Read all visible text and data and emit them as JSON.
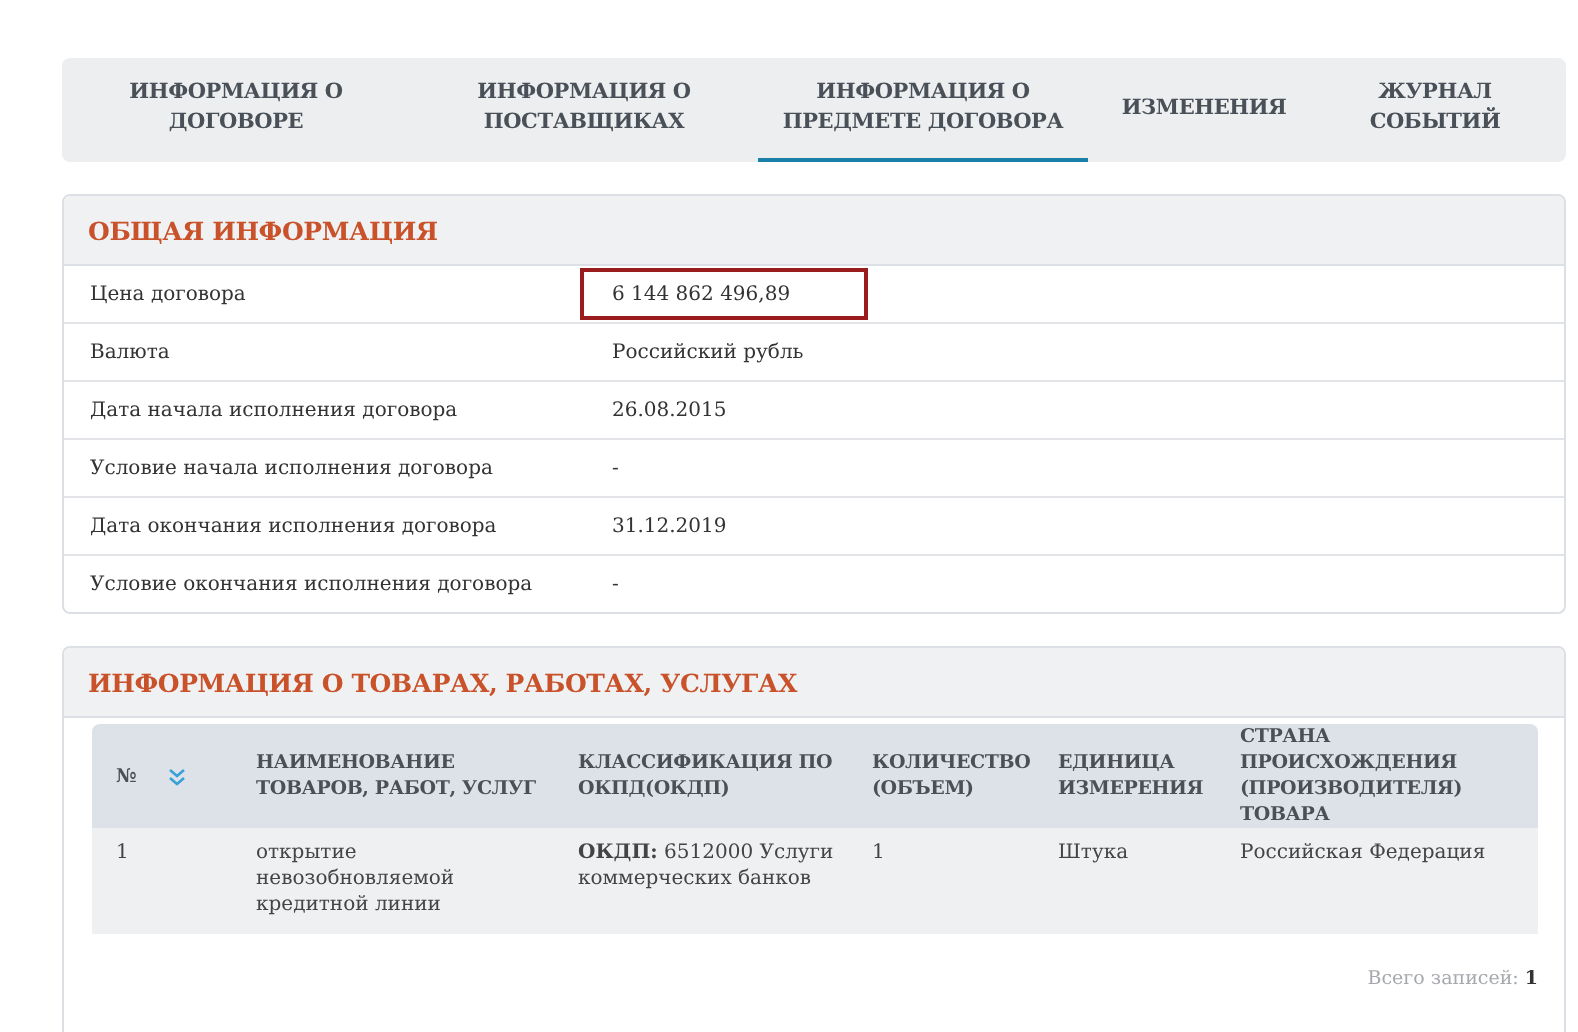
{
  "tabs": [
    {
      "label": "ИНФОРМАЦИЯ О ДОГОВОРЕ",
      "selected": false
    },
    {
      "label": "ИНФОРМАЦИЯ О ПОСТАВЩИКАХ",
      "selected": false
    },
    {
      "label": "ИНФОРМАЦИЯ О ПРЕДМЕТЕ ДОГОВОРА",
      "selected": true
    },
    {
      "label": "ИЗМЕНЕНИЯ",
      "selected": false
    },
    {
      "label": "ЖУРНАЛ СОБЫТИЙ",
      "selected": false
    }
  ],
  "general_info": {
    "title": "ОБЩАЯ ИНФОРМАЦИЯ",
    "rows": [
      {
        "label": "Цена договора",
        "value": "6 144 862 496,89",
        "highlighted": true
      },
      {
        "label": "Валюта",
        "value": "Российский рубль",
        "highlighted": false
      },
      {
        "label": "Дата начала исполнения договора",
        "value": "26.08.2015",
        "highlighted": false
      },
      {
        "label": "Условие начала исполнения договора",
        "value": "-",
        "highlighted": false
      },
      {
        "label": "Дата окончания исполнения договора",
        "value": "31.12.2019",
        "highlighted": false
      },
      {
        "label": "Условие окончания исполнения договора",
        "value": "-",
        "highlighted": false
      }
    ]
  },
  "goods": {
    "title": "ИНФОРМАЦИЯ О ТОВАРАХ, РАБОТАХ, УСЛУГАХ",
    "table": {
      "columns": [
        "№",
        "НАИМЕНОВАНИЕ ТОВАРОВ, РАБОТ, УСЛУГ",
        "КЛАССИФИКАЦИЯ ПО ОКПД(ОКДП)",
        "КОЛИЧЕСТВО (ОБЪЕМ)",
        "ЕДИНИЦА ИЗМЕРЕНИЯ",
        "СТРАНА ПРОИСХОЖДЕНИЯ (ПРОИЗВОДИТЕЛЯ) ТОВАРА"
      ],
      "rows": [
        [
          "1",
          "открытие невозобновляемой кредитной линии",
          "**ОКДП:** 6512000 Услуги коммерческих банков",
          "1",
          "Штука",
          "Российская Федерация"
        ]
      ]
    },
    "total_label": "Всего записей:",
    "total_count": "1"
  }
}
